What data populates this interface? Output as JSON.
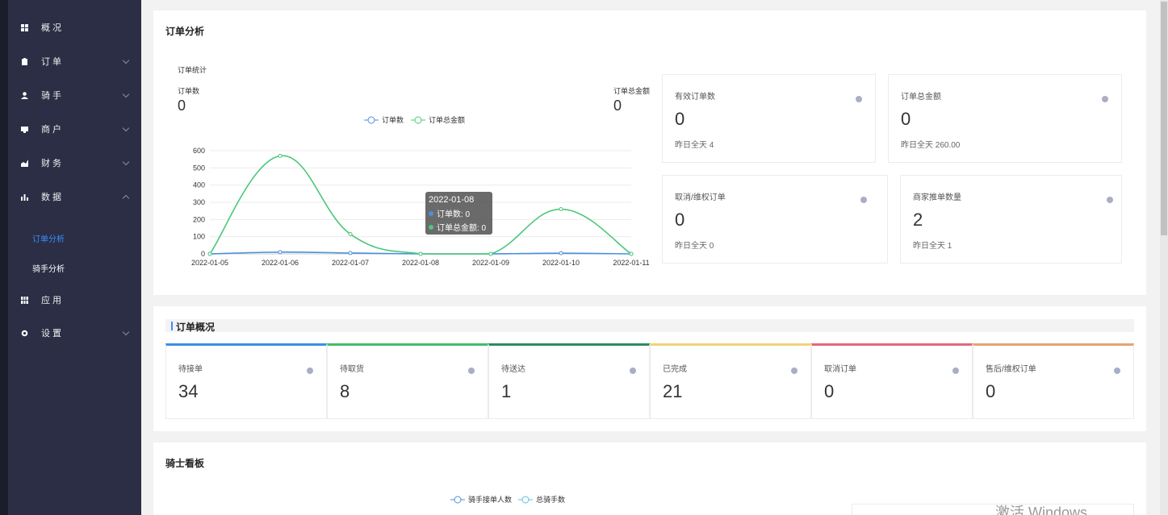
{
  "sidebar": {
    "items": [
      {
        "label": "概 况",
        "icon": "grid-icon"
      },
      {
        "label": "订 单",
        "icon": "clipboard-icon",
        "expandable": true
      },
      {
        "label": "骑 手",
        "icon": "user-icon",
        "expandable": true
      },
      {
        "label": "商 户",
        "icon": "shop-icon",
        "expandable": true
      },
      {
        "label": "财 务",
        "icon": "money-icon",
        "expandable": true
      },
      {
        "label": "数 据",
        "icon": "bar-chart-icon",
        "expandable": true,
        "expanded": true
      },
      {
        "label": "应 用",
        "icon": "apps-icon"
      },
      {
        "label": "设 置",
        "icon": "gear-icon",
        "expandable": true
      }
    ],
    "subitems": [
      {
        "label": "订单分析",
        "active": true
      },
      {
        "label": "骑手分析",
        "active": false
      }
    ],
    "active_color": "#3b8cff"
  },
  "order_analysis": {
    "title": "订单分析",
    "chart_caption": "订单统计",
    "left_metric": {
      "label": "订单数",
      "value": "0"
    },
    "right_metric": {
      "label": "订单总金额",
      "value": "0"
    },
    "tooltip": {
      "date": "2022-01-08",
      "line1": "订单数: 0",
      "line2": "订单总金额: 0"
    },
    "stats": [
      {
        "label": "有效订单数",
        "value": "0",
        "sub": "昨日全天 4"
      },
      {
        "label": "订单总金额",
        "value": "0",
        "sub": "昨日全天 260.00"
      },
      {
        "label": "取消/维权订单",
        "value": "0",
        "sub": "昨日全天 0"
      },
      {
        "label": "商家推单数量",
        "value": "2",
        "sub": "昨日全天 1"
      }
    ]
  },
  "chart_data": {
    "type": "line",
    "x": [
      "2022-01-05",
      "2022-01-06",
      "2022-01-07",
      "2022-01-08",
      "2022-01-09",
      "2022-01-10",
      "2022-01-11"
    ],
    "series": [
      {
        "name": "订单数",
        "values": [
          0,
          10,
          5,
          0,
          0,
          4,
          0
        ],
        "color": "#4a90d9"
      },
      {
        "name": "订单总金额",
        "values": [
          0,
          570,
          115,
          0,
          0,
          260,
          0
        ],
        "color": "#4cc77a"
      }
    ],
    "yticks": [
      "0",
      "100",
      "200",
      "300",
      "400",
      "500",
      "600"
    ],
    "ylim": [
      0,
      600
    ],
    "legend_position": "top-center",
    "grid": true
  },
  "overview": {
    "title": "订单概况",
    "items": [
      {
        "label": "待接单",
        "value": "34",
        "color": "#3d8ee0"
      },
      {
        "label": "待取货",
        "value": "8",
        "color": "#45bc6a"
      },
      {
        "label": "待送达",
        "value": "1",
        "color": "#2e8a5c"
      },
      {
        "label": "已完成",
        "value": "21",
        "color": "#f1d37a"
      },
      {
        "label": "取消订单",
        "value": "0",
        "color": "#e0697c"
      },
      {
        "label": "售后/维权订单",
        "value": "0",
        "color": "#e0a575"
      }
    ]
  },
  "rider_board": {
    "title": "骑士看板",
    "legend": [
      "骑手接单人数",
      "总骑手数"
    ],
    "legend_colors": [
      "#4a90d9",
      "#5bc0de"
    ]
  },
  "watermark": "激活 Windows"
}
